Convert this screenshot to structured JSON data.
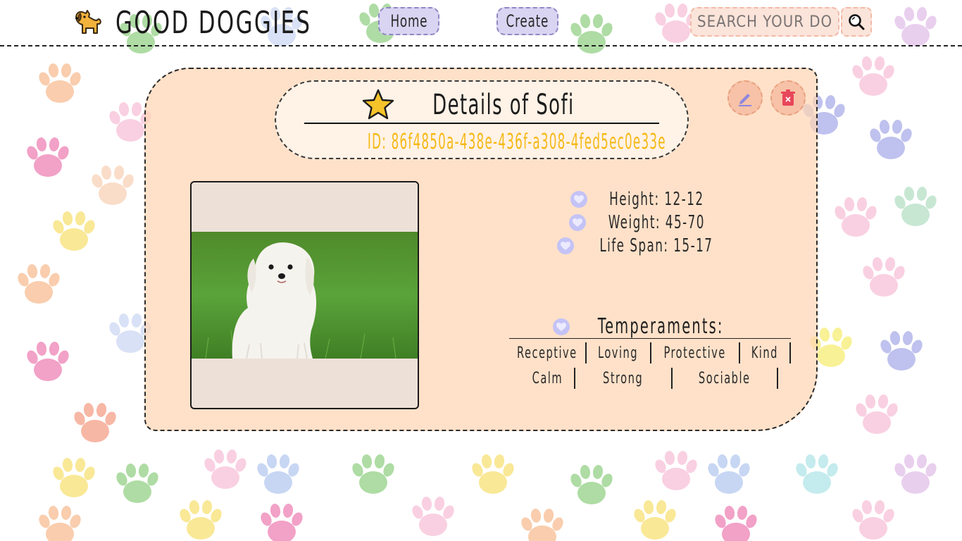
{
  "app": {
    "title": "GOOD DOGGIES",
    "logo_icon": "dog-icon"
  },
  "nav": {
    "home_label": "Home",
    "create_label": "Create"
  },
  "search": {
    "placeholder": "SEARCH YOUR DOGGIE",
    "value": "",
    "button_icon": "search-icon"
  },
  "colors": {
    "card_background": "#ffd9b8",
    "nav_button_bg": "#d9d4f1",
    "id_text": "#f5b915",
    "heart_badge": "#c4c3f6",
    "action_button": "#f7c2a7"
  },
  "detail": {
    "title": "Details of Sofi",
    "title_icon": "star-icon",
    "id": "ID: 86f4850a-438e-436f-a308-4fed5ec0e33e",
    "actions": {
      "edit_icon": "pencil-icon",
      "delete_icon": "trash-icon"
    },
    "image_alt": "White Maltese puppy sitting on grass",
    "stats": {
      "height": "Height: 12-12",
      "weight": "Weight: 45-70",
      "life_span": "Life Span: 15-17"
    },
    "temperaments_label": "Temperaments:",
    "temperaments": [
      "Receptive",
      "Loving",
      "Protective",
      "Kind",
      "Calm",
      "Strong",
      "Sociable"
    ]
  }
}
